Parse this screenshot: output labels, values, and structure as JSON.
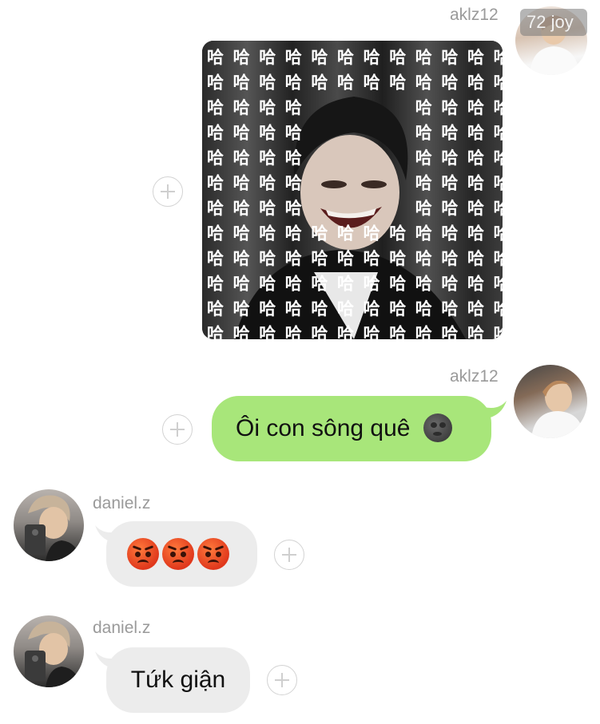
{
  "top_badge": {
    "text": "72 joy"
  },
  "messages": [
    {
      "sender": "aklz12",
      "type": "image",
      "overlay_char": "哈"
    },
    {
      "sender": "aklz12",
      "type": "text",
      "text": "Ôi con sông quê",
      "emoji_icon": "new-moon-face-icon"
    },
    {
      "sender": "daniel.z",
      "type": "emoji",
      "emoji_icons": [
        "angry-face-icon",
        "angry-face-icon",
        "angry-face-icon"
      ]
    },
    {
      "sender": "daniel.z",
      "type": "text",
      "text": "Tứk giận"
    }
  ],
  "colors": {
    "outgoing_bubble": "#a8e67a",
    "incoming_bubble": "#ececec",
    "username": "#9a9a9a"
  }
}
